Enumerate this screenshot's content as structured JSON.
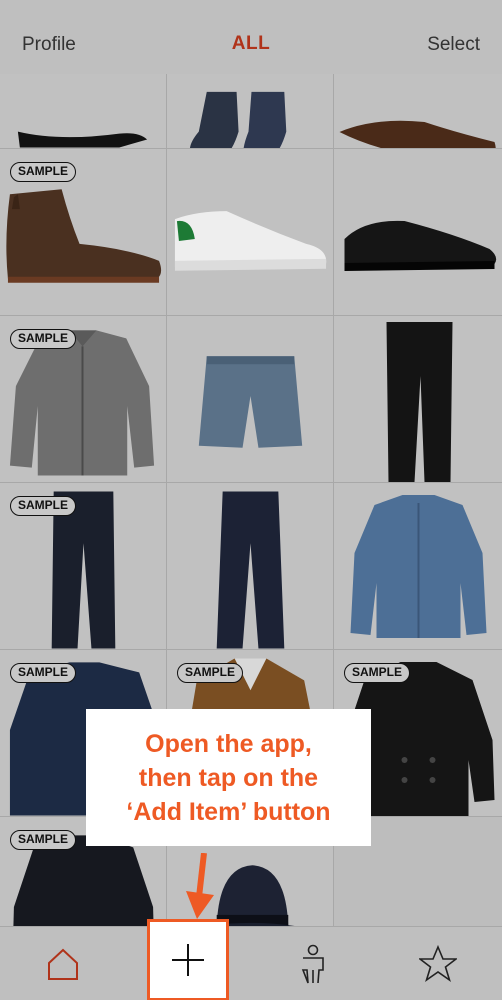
{
  "header": {
    "left_label": "Profile",
    "title": "ALL",
    "right_label": "Select"
  },
  "grid": {
    "badge_label": "SAMPLE",
    "items": [
      {
        "kind": "shoe-dark",
        "badge": false
      },
      {
        "kind": "socks",
        "badge": false
      },
      {
        "kind": "shoe-brown",
        "badge": false
      },
      {
        "kind": "chukka-boot",
        "badge": true
      },
      {
        "kind": "sneaker",
        "badge": true
      },
      {
        "kind": "derby-shoe",
        "badge": true
      },
      {
        "kind": "grey-shirt",
        "badge": true
      },
      {
        "kind": "denim-shorts",
        "badge": true
      },
      {
        "kind": "black-jeans",
        "badge": true
      },
      {
        "kind": "dark-jeans",
        "badge": true
      },
      {
        "kind": "navy-chinos",
        "badge": true
      },
      {
        "kind": "denim-jacket",
        "badge": true
      },
      {
        "kind": "navy-blazer",
        "badge": true
      },
      {
        "kind": "camel-coat",
        "badge": true
      },
      {
        "kind": "peacoat",
        "badge": true
      },
      {
        "kind": "black-cardigan",
        "badge": true
      },
      {
        "kind": "fedora",
        "badge": false
      },
      {
        "kind": "empty",
        "badge": false
      }
    ]
  },
  "callout": {
    "line1": "Open the app,",
    "line2": "then tap on the",
    "line3": "‘Add Item’ button"
  },
  "tabbar": {
    "items": [
      {
        "icon": "home-icon"
      },
      {
        "icon": "plus-icon"
      },
      {
        "icon": "person-icon"
      },
      {
        "icon": "star-icon"
      }
    ]
  },
  "colors": {
    "accent": "#ee5a24",
    "title": "#b0331a",
    "overlay_bg": "#bdbdbd"
  }
}
